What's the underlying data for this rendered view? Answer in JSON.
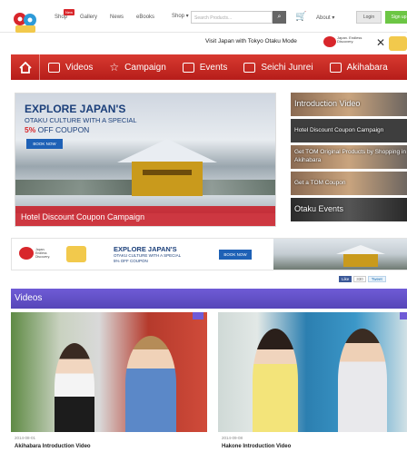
{
  "topnav": {
    "items": [
      "Shop",
      "Gallery",
      "News",
      "eBooks"
    ],
    "new_badge": "New",
    "shop_dropdown": "Shop ▾",
    "search_placeholder": "Search Products...",
    "about": "About ▾",
    "login": "Login",
    "signup": "Sign up"
  },
  "visit": {
    "text": "Visit Japan with Tokyo Otaku Mode",
    "jp_logo_text": "Japan. Endless Discovery."
  },
  "menu": {
    "items": [
      "Videos",
      "Campaign",
      "Events",
      "Seichi Junrei",
      "Akihabara"
    ]
  },
  "hero": {
    "title": "EXPLORE JAPAN'S",
    "subtitle": "OTAKU CULTURE WITH A SPECIAL",
    "coupon_prefix": "5%",
    "coupon_suffix": " OFF COUPON",
    "button": "BOOK NOW",
    "caption": "Hotel Discount Coupon Campaign"
  },
  "side": {
    "items": [
      "Introduction Video",
      "Hotel Discount Coupon Campaign",
      "Get TOM Original Products by Shopping in Akihabara",
      "Get a TOM Coupon",
      "Otaku Events"
    ]
  },
  "banner": {
    "jp_text": "Japan. Endless Discovery.",
    "title": "EXPLORE JAPAN'S",
    "subtitle": "OTAKU CULTURE WITH A SPECIAL",
    "coupon": "5% OFF COUPON",
    "button": "BOOK NOW"
  },
  "social": {
    "like": "Like",
    "like_count": "330",
    "tweet": "Tweet"
  },
  "videos": {
    "heading": "Videos",
    "cards": [
      {
        "date": "2014-08-01",
        "title": "Akihabara Introduction Video"
      },
      {
        "date": "2014-09-08",
        "title": "Hakone Introduction Video"
      }
    ]
  }
}
